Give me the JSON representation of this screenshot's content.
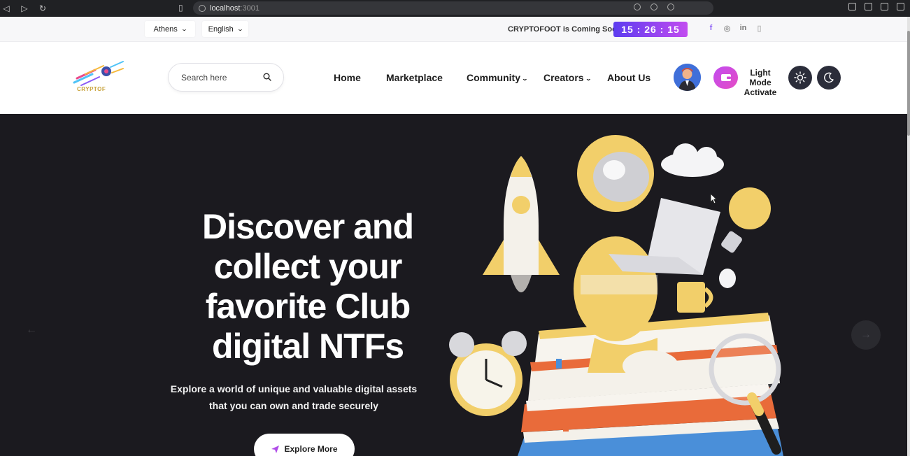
{
  "browser": {
    "url_host": "localhost",
    "url_port": ":3001"
  },
  "topbar": {
    "city": "Athens",
    "language": "English",
    "coming_soon": "CRYPTOFOOT is Coming Soon",
    "timer": "15 : 26 : 15",
    "socials": [
      "f",
      "◎",
      "in",
      "▯"
    ]
  },
  "header": {
    "logo_text": "CRYPTOF",
    "search_placeholder": "Search here",
    "nav": [
      {
        "label": "Home"
      },
      {
        "label": "Marketplace"
      },
      {
        "label": "Community",
        "dropdown": true
      },
      {
        "label": "Creators",
        "dropdown": true
      },
      {
        "label": "About Us"
      }
    ],
    "theme_label_line1": "Light Mode",
    "theme_label_line2": "Activate"
  },
  "hero": {
    "title_lines": [
      "Discover and",
      "collect your",
      "favorite Club",
      "digital NTFs"
    ],
    "subtitle_line1": "Explore a world of unique and valuable digital assets",
    "subtitle_line2": "that you can own and trade securely",
    "cta_label": "Explore More"
  },
  "icons": {
    "search": "search-icon",
    "wallet": "wallet-icon",
    "sun": "sun-icon",
    "moon": "moon-icon",
    "send": "paper-plane-icon",
    "prev": "arrow-left-icon",
    "next": "arrow-right-icon"
  },
  "colors": {
    "accent_gradient_start": "#5c3cf0",
    "accent_gradient_end": "#c24cf0",
    "hero_bg": "#1b1a1f",
    "illustration_yellow": "#f2cf6a"
  }
}
